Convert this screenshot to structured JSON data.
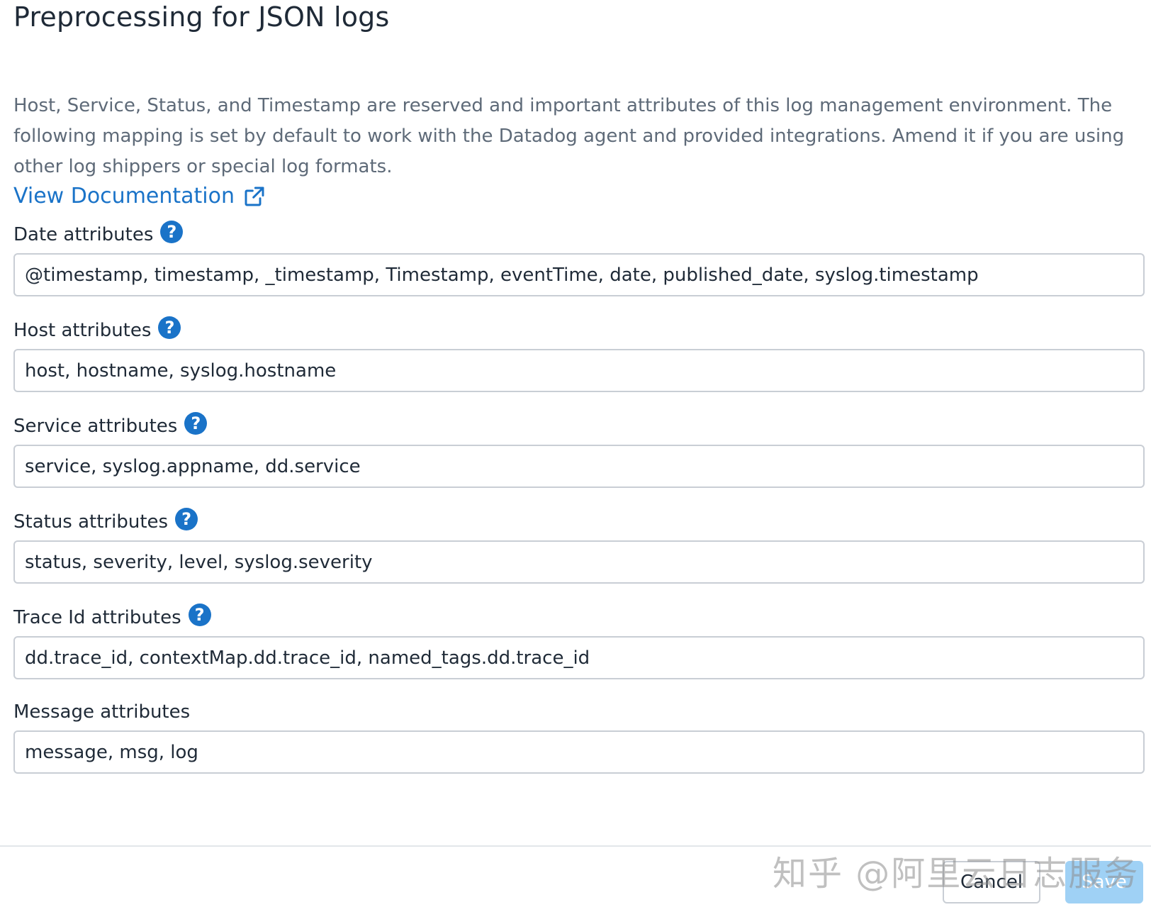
{
  "page": {
    "title": "Preprocessing for JSON logs",
    "description": "Host, Service, Status, and Timestamp are reserved and important attributes of this log management environment. The following mapping is set by default to work with the Datadog agent and provided integrations. Amend it if you are using other log shippers or special log formats.",
    "doc_link_label": "View Documentation"
  },
  "fields": {
    "date": {
      "label": "Date attributes",
      "value": "@timestamp, timestamp, _timestamp, Timestamp, eventTime, date, published_date, syslog.timestamp",
      "help": "?"
    },
    "host": {
      "label": "Host attributes",
      "value": "host, hostname, syslog.hostname",
      "help": "?"
    },
    "service": {
      "label": "Service attributes",
      "value": "service, syslog.appname, dd.service",
      "help": "?"
    },
    "status": {
      "label": "Status attributes",
      "value": "status, severity, level, syslog.severity",
      "help": "?"
    },
    "trace_id": {
      "label": "Trace Id attributes",
      "value": "dd.trace_id, contextMap.dd.trace_id, named_tags.dd.trace_id",
      "help": "?"
    },
    "message": {
      "label": "Message attributes",
      "value": "message, msg, log"
    }
  },
  "footer": {
    "cancel_label": "Cancel",
    "save_label": "Save"
  },
  "watermark": "知乎 @阿里云日志服务",
  "colors": {
    "accent": "#1a73c8",
    "save_disabled": "#9fd1f5"
  },
  "icons": {
    "doc_link": "external-link-icon",
    "help": "help-circle-icon"
  }
}
